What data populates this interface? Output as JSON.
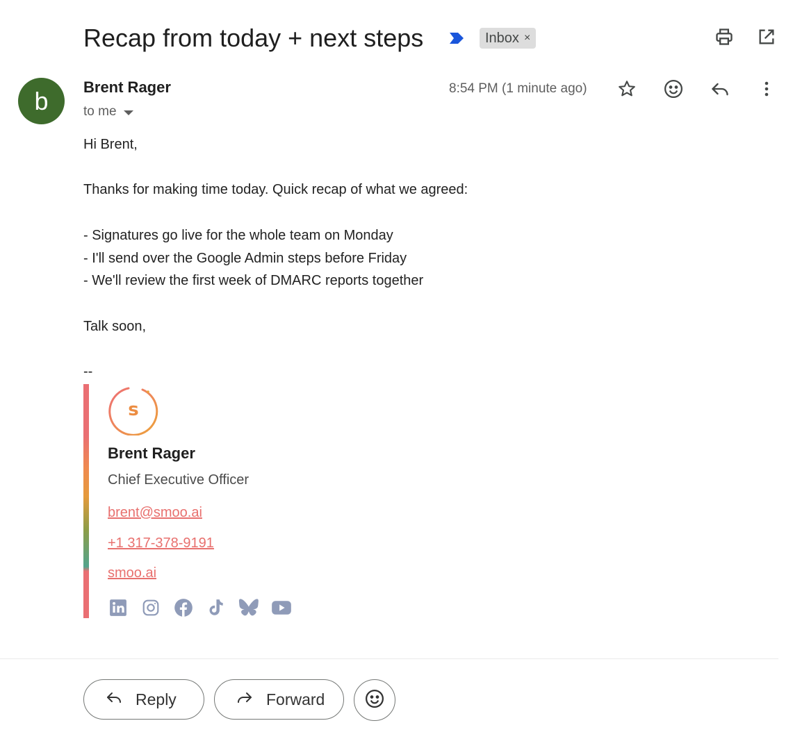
{
  "email": {
    "subject": "Recap from today + next steps",
    "label": "Inbox",
    "label_remove": "×",
    "sender_initial": "b",
    "sender_name": "Brent Rager",
    "recipient": "to me",
    "timestamp": "8:54 PM (1 minute ago)"
  },
  "body": {
    "greeting": "Hi Brent,",
    "intro": "Thanks for making time today. Quick recap of what we agreed:",
    "items": [
      "- Signatures go live for the whole team on Monday",
      "- I'll send over the Google Admin steps before Friday",
      "- We'll review the first week of DMARC reports together"
    ],
    "closing": "Talk soon,",
    "separator": "--"
  },
  "signature": {
    "logo_letter": "s",
    "name": "Brent Rager",
    "title": "Chief Executive Officer",
    "email": "brent@smoo.ai",
    "phone": "+1 317-378-9191",
    "website": "smoo.ai",
    "socials": [
      "linkedin-icon",
      "instagram-icon",
      "facebook-icon",
      "tiktok-icon",
      "bluesky-icon",
      "youtube-icon"
    ]
  },
  "actions": {
    "reply": "Reply",
    "forward": "Forward"
  },
  "colors": {
    "avatar": "#3e6b2c",
    "importance_marker": "#1a56db",
    "signature_link": "#e8706e",
    "social_icon": "#8f9bb8"
  }
}
